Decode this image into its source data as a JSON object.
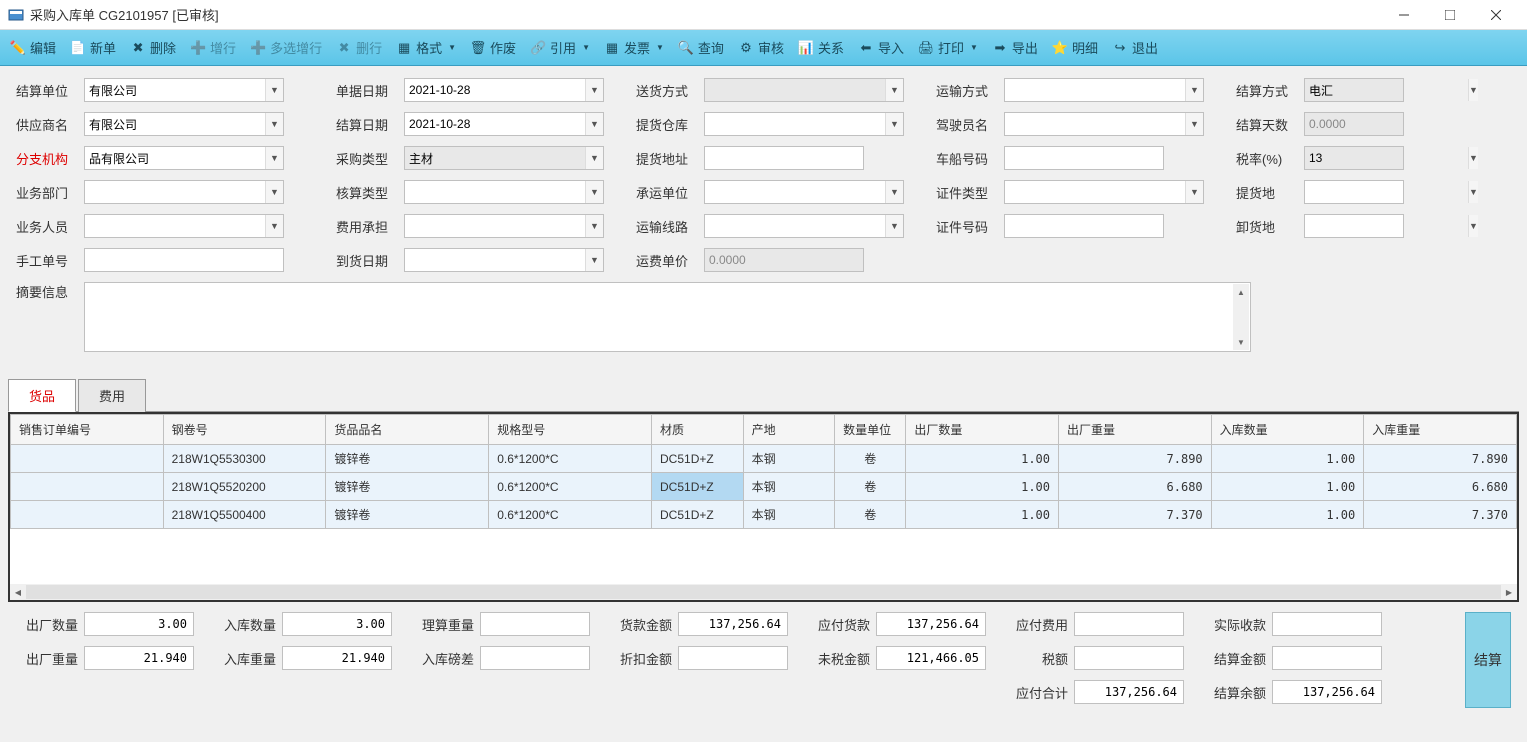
{
  "window": {
    "title": "采购入库单 CG2101957  [已审核]"
  },
  "toolbar": [
    {
      "id": "edit",
      "label": "编辑",
      "icon": "✏️"
    },
    {
      "id": "new",
      "label": "新单",
      "icon": "📄"
    },
    {
      "id": "delete",
      "label": "删除",
      "icon": "✖"
    },
    {
      "id": "addrow",
      "label": "增行",
      "icon": "➕",
      "disabled": true
    },
    {
      "id": "multiadd",
      "label": "多选增行",
      "icon": "➕",
      "disabled": true
    },
    {
      "id": "delrow",
      "label": "删行",
      "icon": "✖",
      "disabled": true
    },
    {
      "id": "format",
      "label": "格式",
      "icon": "▦",
      "dd": true
    },
    {
      "id": "void",
      "label": "作废",
      "icon": "🗑"
    },
    {
      "id": "ref",
      "label": "引用",
      "icon": "🔗",
      "dd": true
    },
    {
      "id": "invoice",
      "label": "发票",
      "icon": "▦",
      "dd": true
    },
    {
      "id": "query",
      "label": "查询",
      "icon": "🔍"
    },
    {
      "id": "audit",
      "label": "审核",
      "icon": "⚙"
    },
    {
      "id": "relation",
      "label": "关系",
      "icon": "📊"
    },
    {
      "id": "import",
      "label": "导入",
      "icon": "⬅"
    },
    {
      "id": "print",
      "label": "打印",
      "icon": "🖨",
      "dd": true
    },
    {
      "id": "export",
      "label": "导出",
      "icon": "➡"
    },
    {
      "id": "detail",
      "label": "明细",
      "icon": "⭐"
    },
    {
      "id": "exit",
      "label": "退出",
      "icon": "↪"
    }
  ],
  "form": {
    "settle_unit": {
      "label": "结算单位",
      "value": "有限公司"
    },
    "doc_date": {
      "label": "单据日期",
      "value": "2021-10-28"
    },
    "delivery_method": {
      "label": "送货方式",
      "value": ""
    },
    "transport_method": {
      "label": "运输方式",
      "value": ""
    },
    "settle_method": {
      "label": "结算方式",
      "value": "电汇"
    },
    "supplier": {
      "label": "供应商名",
      "value": "有限公司"
    },
    "settle_date": {
      "label": "结算日期",
      "value": "2021-10-28"
    },
    "pickup_wh": {
      "label": "提货仓库",
      "value": ""
    },
    "driver": {
      "label": "驾驶员名",
      "value": ""
    },
    "settle_days": {
      "label": "结算天数",
      "value": "0.0000"
    },
    "branch": {
      "label": "分支机构",
      "value": "品有限公司",
      "red": true
    },
    "purchase_type": {
      "label": "采购类型",
      "value": "主材"
    },
    "pickup_addr": {
      "label": "提货地址",
      "value": ""
    },
    "vehicle_no": {
      "label": "车船号码",
      "value": ""
    },
    "tax_rate": {
      "label": "税率(%)",
      "value": "13"
    },
    "dept": {
      "label": "业务部门",
      "value": ""
    },
    "account_type": {
      "label": "核算类型",
      "value": ""
    },
    "carrier": {
      "label": "承运单位",
      "value": ""
    },
    "cert_type": {
      "label": "证件类型",
      "value": ""
    },
    "pickup_place": {
      "label": "提货地",
      "value": ""
    },
    "staff": {
      "label": "业务人员",
      "value": ""
    },
    "expense_bearer": {
      "label": "费用承担",
      "value": ""
    },
    "route": {
      "label": "运输线路",
      "value": ""
    },
    "cert_no": {
      "label": "证件号码",
      "value": ""
    },
    "unload_place": {
      "label": "卸货地",
      "value": ""
    },
    "manual_no": {
      "label": "手工单号",
      "value": ""
    },
    "arrive_date": {
      "label": "到货日期",
      "value": ""
    },
    "freight_price": {
      "label": "运费单价",
      "value": "0.0000"
    },
    "summary": {
      "label": "摘要信息",
      "value": ""
    }
  },
  "tabs": [
    {
      "label": "货品",
      "active": true
    },
    {
      "label": "费用",
      "active": false
    }
  ],
  "grid": {
    "headers": [
      "销售订单编号",
      "钢卷号",
      "货品品名",
      "规格型号",
      "材质",
      "产地",
      "数量单位",
      "出厂数量",
      "出厂重量",
      "入库数量",
      "入库重量"
    ],
    "rows": [
      {
        "order": "",
        "coil": "218W1Q5530300",
        "name": "镀锌卷",
        "spec": "0.6*1200*C",
        "mat": "DC51D+Z",
        "origin": "本钢",
        "unit": "卷",
        "qty_out": "1.00",
        "wt_out": "7.890",
        "qty_in": "1.00",
        "wt_in": "7.890"
      },
      {
        "order": "",
        "coil": "218W1Q5520200",
        "name": "镀锌卷",
        "spec": "0.6*1200*C",
        "mat": "DC51D+Z",
        "origin": "本钢",
        "unit": "卷",
        "qty_out": "1.00",
        "wt_out": "6.680",
        "qty_in": "1.00",
        "wt_in": "6.680",
        "sel_mat": true
      },
      {
        "order": "",
        "coil": "218W1Q5500400",
        "name": "镀锌卷",
        "spec": "0.6*1200*C",
        "mat": "DC51D+Z",
        "origin": "本钢",
        "unit": "卷",
        "qty_out": "1.00",
        "wt_out": "7.370",
        "qty_in": "1.00",
        "wt_in": "7.370"
      }
    ]
  },
  "totals": {
    "out_qty": {
      "label": "出厂数量",
      "value": "3.00"
    },
    "in_qty": {
      "label": "入库数量",
      "value": "3.00"
    },
    "calc_wt": {
      "label": "理算重量",
      "value": ""
    },
    "goods_amt": {
      "label": "货款金额",
      "value": "137,256.64"
    },
    "payable_goods": {
      "label": "应付货款",
      "value": "137,256.64"
    },
    "payable_fee": {
      "label": "应付费用",
      "value": ""
    },
    "actual_recv": {
      "label": "实际收款",
      "value": ""
    },
    "out_wt": {
      "label": "出厂重量",
      "value": "21.940"
    },
    "in_wt": {
      "label": "入库重量",
      "value": "21.940"
    },
    "in_diff": {
      "label": "入库磅差",
      "value": ""
    },
    "discount": {
      "label": "折扣金额",
      "value": ""
    },
    "untaxed": {
      "label": "未税金额",
      "value": "121,466.05"
    },
    "tax_amt": {
      "label": "税额",
      "value": ""
    },
    "settle_amt": {
      "label": "结算金额",
      "value": ""
    },
    "payable_total": {
      "label": "应付合计",
      "value": "137,256.64"
    },
    "settle_balance": {
      "label": "结算余额",
      "value": "137,256.64"
    },
    "calc_btn": "结算"
  }
}
